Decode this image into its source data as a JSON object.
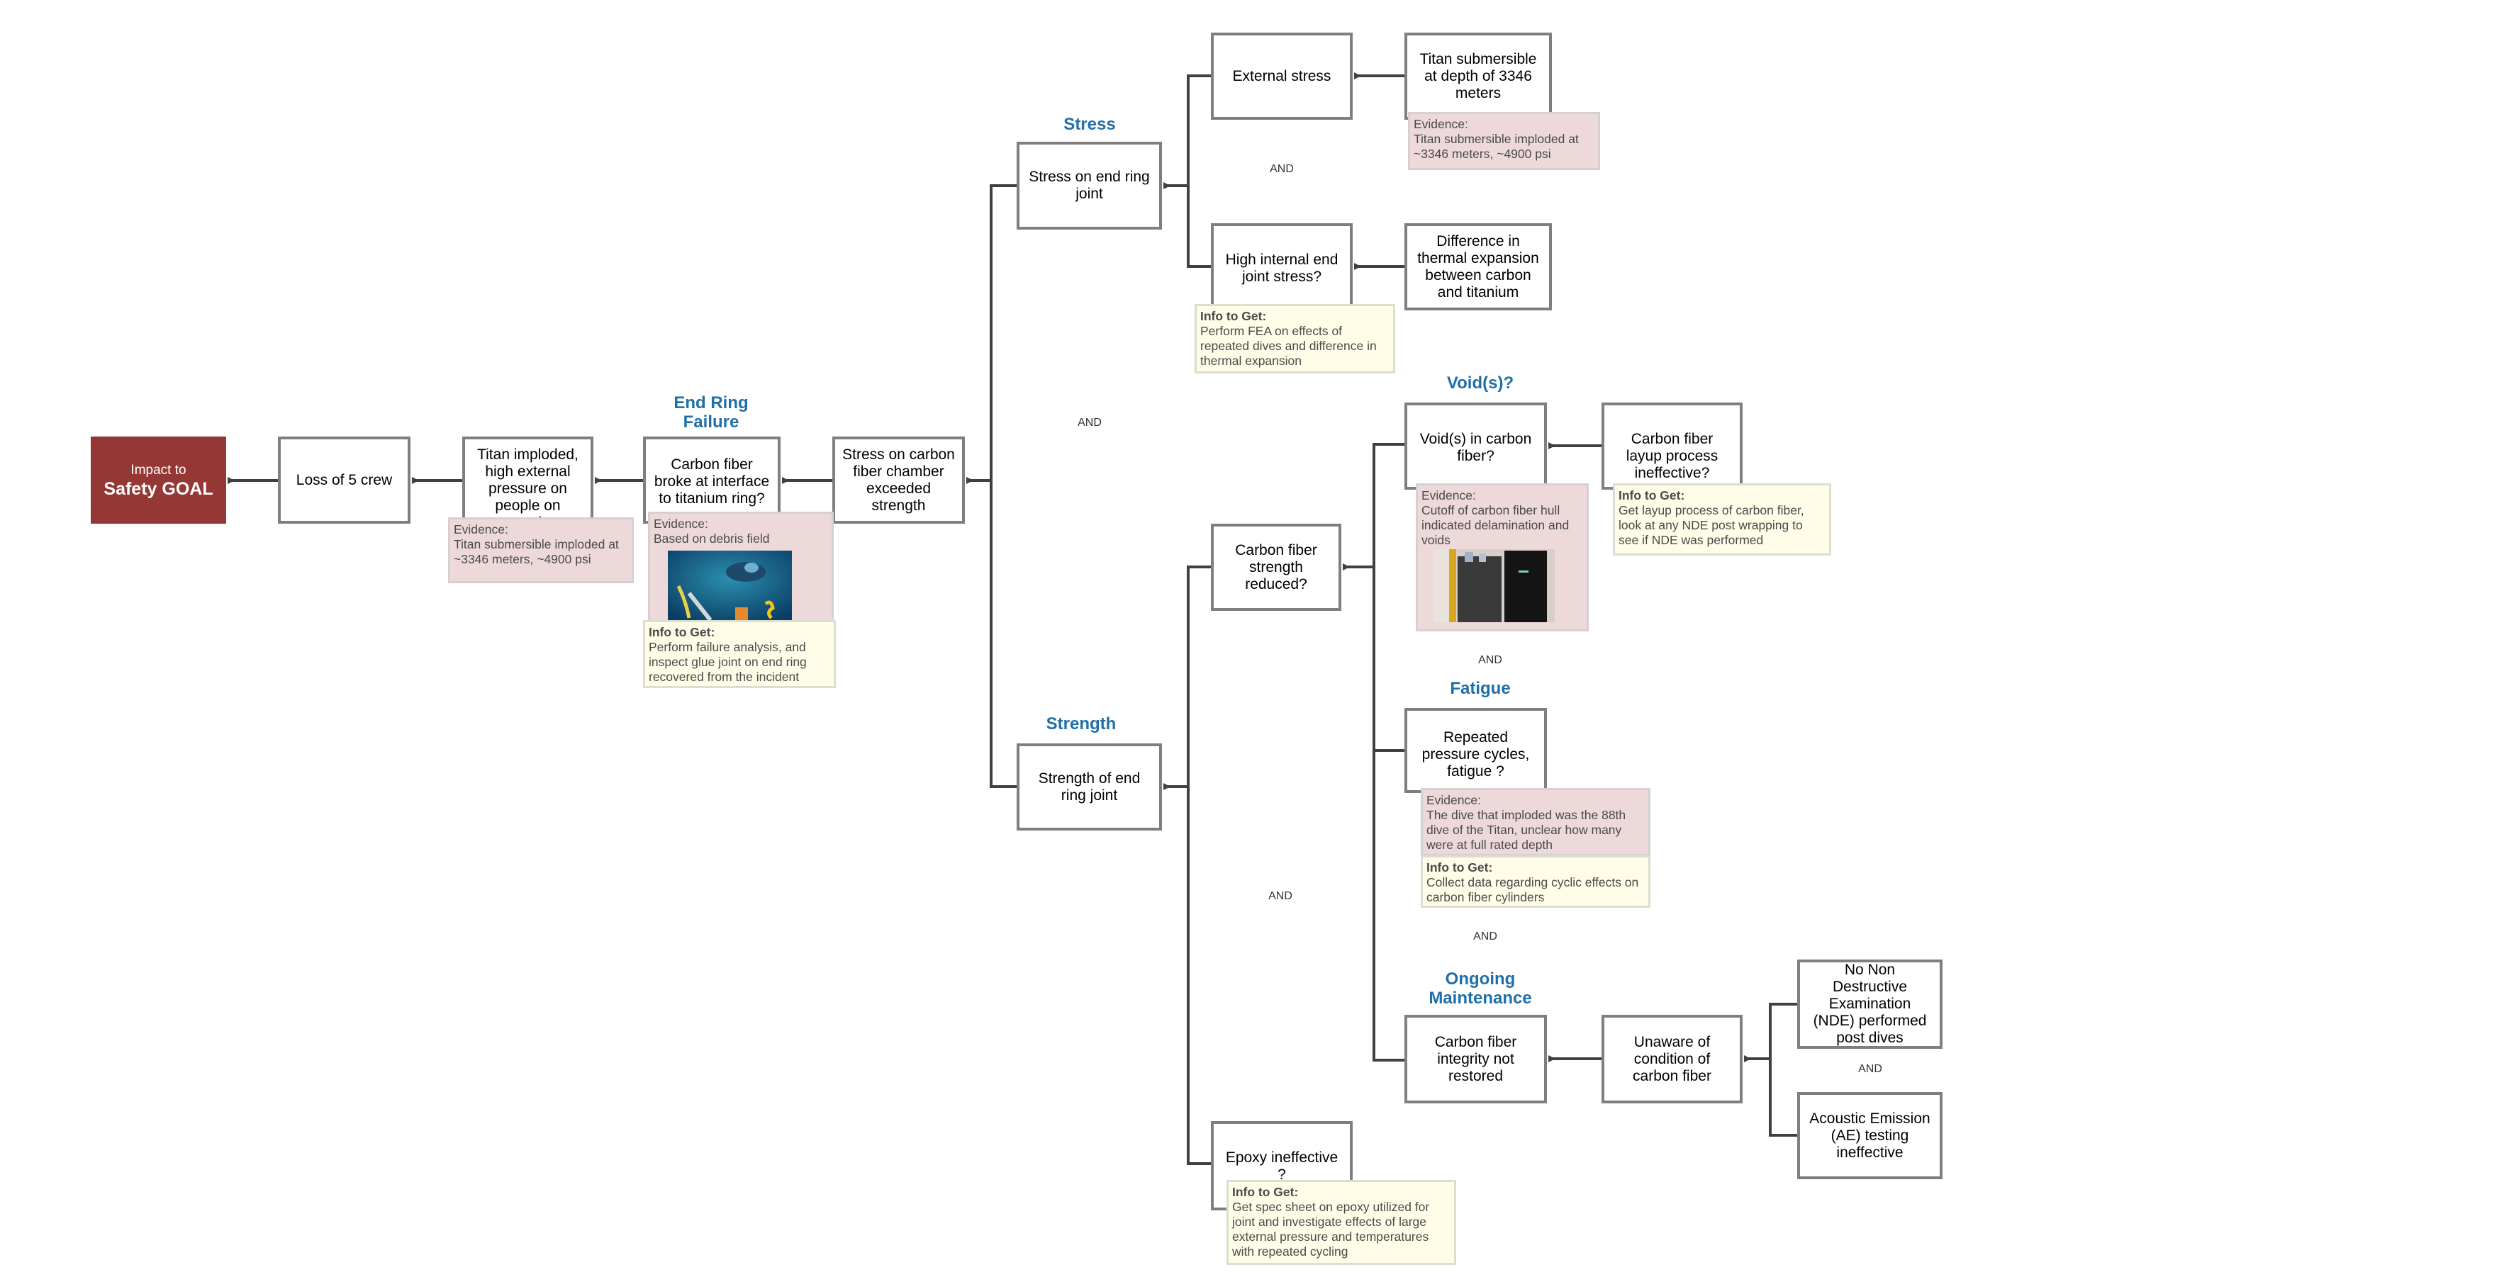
{
  "goal": {
    "line1": "Impact to",
    "line2": "Safety GOAL",
    "color": "#953735"
  },
  "categories": {
    "end_ring_failure": "End Ring Failure",
    "stress": "Stress",
    "strength": "Strength",
    "voids": "Void(s)?",
    "fatigue": "Fatigue",
    "ongoing_maintenance": "Ongoing Maintenance"
  },
  "nodes": {
    "loss_of_crew": "Loss of 5 crew",
    "titan_imploded": "Titan imploded, high external pressure on people on people",
    "carbon_fiber_broke": "Carbon fiber broke at interface to titanium ring?",
    "stress_exceeded_strength": "Stress on carbon fiber chamber exceeded strength",
    "stress_end_ring_joint": "Stress on end ring joint",
    "external_stress": "External stress",
    "titan_depth": "Titan submersible at depth of 3346 meters",
    "high_internal_stress": "High internal end joint stress?",
    "thermal_expansion": "Difference in thermal expansion between carbon and titanium",
    "strength_end_ring_joint": "Strength of end ring joint",
    "cf_strength_reduced": "Carbon fiber strength reduced?",
    "voids_in_cf": "Void(s) in carbon fiber?",
    "layup_ineffective": "Carbon fiber layup process ineffective?",
    "repeated_cycles": "Repeated pressure cycles, fatigue ?",
    "cf_integrity": "Carbon fiber integrity not restored",
    "unaware_condition": "Unaware of condition of carbon fiber",
    "no_nde": "No Non Destructive Examination (NDE) performed post dives",
    "ae_ineffective": "Acoustic Emission (AE) testing ineffective",
    "epoxy_ineffective": "Epoxy ineffective ?"
  },
  "notes": {
    "evidence_label": "Evidence:",
    "info_label": "Info to Get:",
    "titan_imploded_evidence": "Titan submersible imploded at ~3346 meters, ~4900 psi",
    "carbon_fiber_broke_evidence": "Based on debris field",
    "carbon_fiber_broke_info": "Perform failure analysis, and inspect glue joint on end ring recovered from the incident",
    "titan_depth_evidence": "Titan submersible imploded at ~3346 meters, ~4900 psi",
    "high_internal_info": "Perform FEA on effects of repeated dives and difference in thermal expansion",
    "voids_evidence": "Cutoff of carbon fiber hull indicated delamination and voids",
    "layup_info": "Get layup process of carbon fiber, look at any NDE post wrapping to see if NDE was performed",
    "fatigue_evidence": "The dive that imploded was the 88th dive of the Titan, unclear how many were at full rated depth",
    "fatigue_info": "Collect data regarding cyclic effects on carbon fiber cylinders",
    "epoxy_info": "Get spec sheet on epoxy utilized for joint and investigate effects of large external pressure and temperatures with repeated cycling"
  },
  "gates": {
    "and": "AND"
  },
  "colors": {
    "category": "#1f6fa8",
    "evidence_bg": "#eed9da",
    "info_bg": "#fffde8",
    "connector": "#404040",
    "box_border": "#7f7f7f"
  }
}
